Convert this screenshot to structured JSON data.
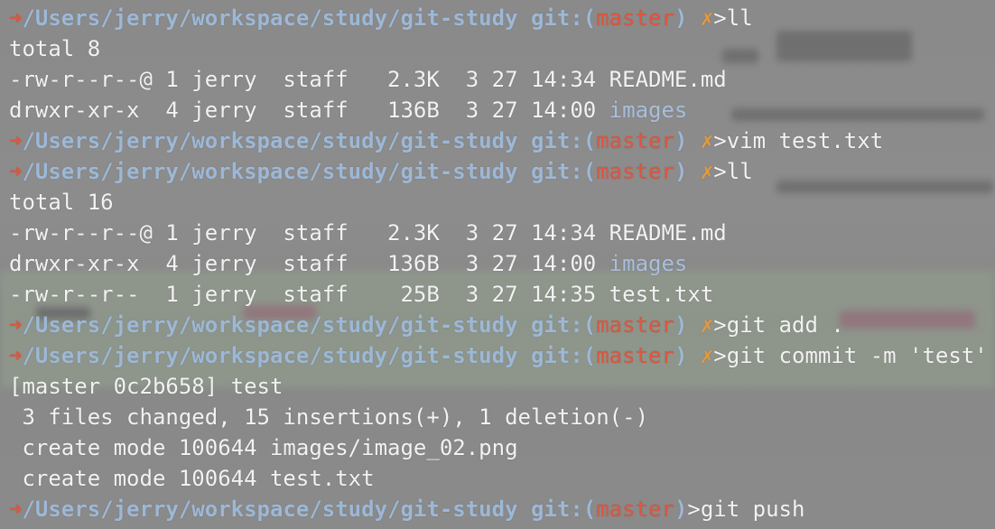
{
  "prompt": {
    "arrow": "➜",
    "path": "/Users/jerry/workspace/study/git-study",
    "git_label": "git:",
    "open_paren": "(",
    "close_paren": ")",
    "branch": "master",
    "dirty_mark": "✗"
  },
  "lines": [
    {
      "type": "prompt",
      "dirty": true,
      "command": ">ll"
    },
    {
      "type": "output",
      "text": "total 8"
    },
    {
      "type": "listing",
      "text": "-rw-r--r--@ 1 jerry  staff   2.3K  3 27 14:34 ",
      "name": "README.md",
      "is_dir": false
    },
    {
      "type": "listing",
      "text": "drwxr-xr-x  4 jerry  staff   136B  3 27 14:00 ",
      "name": "images",
      "is_dir": true
    },
    {
      "type": "prompt",
      "dirty": true,
      "command": ">vim test.txt"
    },
    {
      "type": "prompt",
      "dirty": true,
      "command": ">ll"
    },
    {
      "type": "output",
      "text": "total 16"
    },
    {
      "type": "listing",
      "text": "-rw-r--r--@ 1 jerry  staff   2.3K  3 27 14:34 ",
      "name": "README.md",
      "is_dir": false
    },
    {
      "type": "listing",
      "text": "drwxr-xr-x  4 jerry  staff   136B  3 27 14:00 ",
      "name": "images",
      "is_dir": true
    },
    {
      "type": "listing",
      "text": "-rw-r--r--  1 jerry  staff    25B  3 27 14:35 ",
      "name": "test.txt",
      "is_dir": false
    },
    {
      "type": "prompt",
      "dirty": true,
      "command": ">git add ."
    },
    {
      "type": "prompt",
      "dirty": true,
      "command": ">git commit -m 'test'"
    },
    {
      "type": "output",
      "text": "[master 0c2b658] test"
    },
    {
      "type": "output",
      "text": " 3 files changed, 15 insertions(+), 1 deletion(-)"
    },
    {
      "type": "output",
      "text": " create mode 100644 images/image_02.png"
    },
    {
      "type": "output",
      "text": " create mode 100644 test.txt"
    },
    {
      "type": "prompt",
      "dirty": false,
      "command": ">git push"
    }
  ],
  "colors": {
    "arrow": "#e0553e",
    "path": "#9db8d6",
    "branch": "#e0553e",
    "dirty": "#e79a3e",
    "text": "#f2f2f2",
    "dir": "#a9bfdc"
  }
}
